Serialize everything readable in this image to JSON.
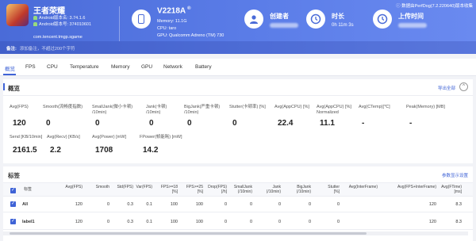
{
  "app": {
    "name": "王者荣耀",
    "android_version": "Android版本名: 3.74.1.6",
    "android_code": "Android版本号: 374010601",
    "package": "com.tencent.tmgp.sgame"
  },
  "device": {
    "name": "V2218A",
    "badge": "®",
    "memory": "Memory: 11.1G",
    "cpu": "CPU: taro",
    "gpu": "GPU: Qualcomm Adreno (TM) 730"
  },
  "stats": {
    "creator_label": "创建者",
    "duration_label": "时长",
    "duration_value": "0h 11m 3s",
    "upload_label": "上传时间"
  },
  "perf_note": "数据由PerfDog(7.2.220640)版本收集",
  "note": {
    "label": "备注:",
    "placeholder": "添加备注，不超过200个字符"
  },
  "tabs": [
    "概览",
    "FPS",
    "CPU",
    "Temperature",
    "Memory",
    "GPU",
    "Network",
    "Battery"
  ],
  "overview": {
    "title": "概览",
    "export": "导出全部",
    "collapse": "^",
    "row1": [
      {
        "label": "Avg(FPS)",
        "value": "120"
      },
      {
        "label": "Smooth(流畅度指数)",
        "value": "0"
      },
      {
        "label": "SmallJank(微小卡顿)\n/10min)",
        "value": "0"
      },
      {
        "label": "Jank(卡顿)\n/10min)",
        "value": "0"
      },
      {
        "label": "BigJank(严重卡顿)\n/10min)",
        "value": "0"
      },
      {
        "label": "Stutter(卡顿率) [%]",
        "value": "0"
      },
      {
        "label": "Avg(AppCPU) [%]",
        "value": "22.4"
      },
      {
        "label": "Avg(AppCPU) [%]\nNormalized",
        "value": "11.1"
      },
      {
        "label": "Avg(CTemp)[℃]",
        "value": "-"
      },
      {
        "label": "Peak(Memory) [MB]",
        "value": "-"
      }
    ],
    "row2": [
      {
        "label": "Send [KB/10min]",
        "value": "2161.5"
      },
      {
        "label": "Avg(Recv) [KB/s]",
        "value": "2.2"
      },
      {
        "label": "Avg(Power) [mW]",
        "value": "1708"
      },
      {
        "label": "FPower(帧能耗) [mW]",
        "value": "14.2"
      }
    ]
  },
  "labels_section": {
    "title": "标签",
    "settings": "参数显示设置",
    "headers": [
      "标签",
      "Avg(FPS)",
      "Smooth",
      "Std(FPS)",
      "Var(FPS)",
      "FPS>=18\n[%]",
      "FPS>=25\n[%]",
      "Drop(FPS)\n[/h]",
      "SmallJank\n(/10min)",
      "Jank\n(/10min)",
      "BigJank\n(/10min)",
      "Stutter\n[%]",
      "Avg(InterFrame)",
      "Avg(FPS+InterFrame)",
      "Avg(FTime)\n[ms]"
    ],
    "rows": [
      {
        "name": "All",
        "cells": [
          "120",
          "0",
          "0.3",
          "0.1",
          "100",
          "100",
          "0",
          "0",
          "0",
          "0",
          "0",
          "",
          "120",
          "8.3"
        ]
      },
      {
        "name": "label1",
        "cells": [
          "120",
          "0",
          "0.3",
          "0.1",
          "100",
          "100",
          "0",
          "0",
          "0",
          "0",
          "0",
          "",
          "120",
          "8.3"
        ]
      }
    ]
  }
}
